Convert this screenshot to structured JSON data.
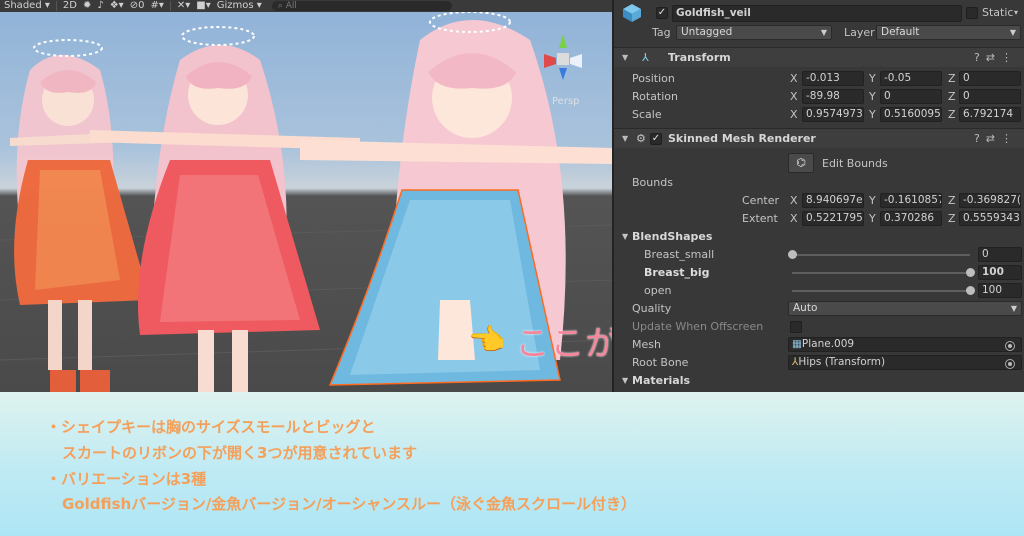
{
  "scene": {
    "toolbar": {
      "shading": "Shaded",
      "mode2d": "2D",
      "hidden_count": "0",
      "gizmos": "Gizmos",
      "search_placeholder": "All"
    },
    "projection_label": "Persp",
    "annotation": "ここが開きます"
  },
  "inspector": {
    "object_name": "Goldfish_veil",
    "static_label": "Static",
    "tag_label": "Tag",
    "tag_value": "Untagged",
    "layer_label": "Layer",
    "layer_value": "Default",
    "transform": {
      "title": "Transform",
      "position_label": "Position",
      "rotation_label": "Rotation",
      "scale_label": "Scale",
      "position": {
        "x": "-0.013",
        "y": "-0.05",
        "z": "0"
      },
      "rotation": {
        "x": "-89.98",
        "y": "0",
        "z": "0"
      },
      "scale": {
        "x": "0.9574973",
        "y": "0.5160095",
        "z": "6.792174"
      }
    },
    "skinned": {
      "title": "Skinned Mesh Renderer",
      "edit_bounds": "Edit Bounds",
      "bounds_label": "Bounds",
      "center_label": "Center",
      "extent_label": "Extent",
      "center": {
        "x": "8.940697e-",
        "y": "-0.1610857",
        "z": "-0.369827("
      },
      "extent": {
        "x": "0.5221795",
        "y": "0.370286",
        "z": "0.5559343"
      },
      "blendshapes_label": "BlendShapes",
      "blendshapes": [
        {
          "name": "Breast_small",
          "value": "0",
          "level": 0
        },
        {
          "name": "Breast_big",
          "value": "100",
          "level": 1
        },
        {
          "name": "open",
          "value": "100",
          "level": 1
        }
      ],
      "quality_label": "Quality",
      "quality_value": "Auto",
      "update_label": "Update When Offscreen",
      "mesh_label": "Mesh",
      "mesh_value": "Plane.009",
      "root_bone_label": "Root Bone",
      "root_bone_value": "Hips (Transform)",
      "materials_label": "Materials"
    }
  },
  "caption": {
    "line1": "・シェイプキーは胸のサイズスモールとビッグと",
    "line2": "スカートのリボンの下が開く3つが用意されています",
    "line3": "・バリエーションは3種",
    "line4": "Goldfishバージョン/金魚バージョン/オーシャンスルー（泳ぐ金魚スクロール付き）"
  },
  "colors": {
    "annotation": "#f7869c",
    "caption_text": "#f4a05a",
    "inspector_bg": "#383838"
  }
}
